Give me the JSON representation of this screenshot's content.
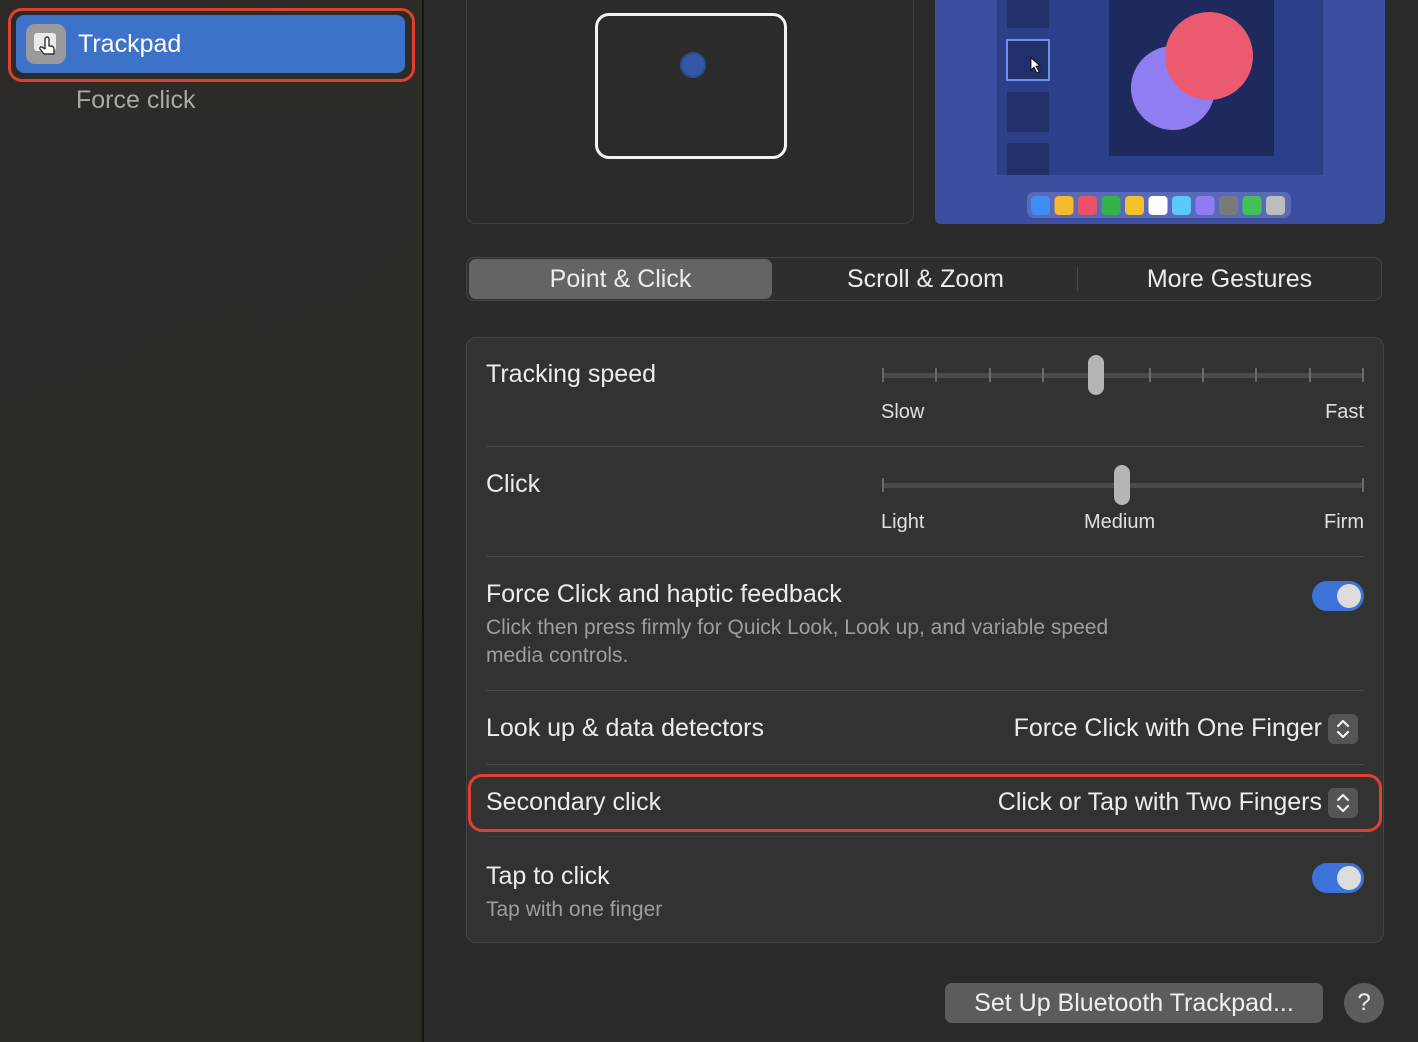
{
  "sidebar": {
    "selected_item": {
      "label": "Trackpad",
      "icon": "trackpad-hand-icon"
    },
    "sub_item": {
      "label": "Force click"
    }
  },
  "preview": {
    "trackpad_icon": "trackpad-outline-icon",
    "dock_colors": [
      "#3d8ef5",
      "#f5b92e",
      "#ea5367",
      "#36b24a",
      "#f3c12a",
      "#ffffff",
      "#5ac8fa",
      "#8e7cf0",
      "#7a7a7a",
      "#42c15a",
      "#bdbdbd"
    ]
  },
  "tabs": [
    {
      "label": "Point & Click",
      "active": true
    },
    {
      "label": "Scroll & Zoom",
      "active": false
    },
    {
      "label": "More Gestures",
      "active": false
    }
  ],
  "settings": {
    "tracking_speed": {
      "title": "Tracking speed",
      "min_label": "Slow",
      "max_label": "Fast",
      "ticks": 10,
      "value_index": 4
    },
    "click": {
      "title": "Click",
      "labels": [
        "Light",
        "Medium",
        "Firm"
      ],
      "value_index": 1
    },
    "force_click": {
      "title": "Force Click and haptic feedback",
      "description_line1": "Click then press firmly for Quick Look, Look up, and variable speed",
      "description_line2": "media controls.",
      "enabled": true
    },
    "look_up": {
      "title": "Look up & data detectors",
      "value": "Force Click with One Finger"
    },
    "secondary_click": {
      "title": "Secondary click",
      "value": "Click or Tap with Two Fingers"
    },
    "tap_to_click": {
      "title": "Tap to click",
      "description": "Tap with one finger",
      "enabled": true
    }
  },
  "footer": {
    "bluetooth_button": "Set Up Bluetooth Trackpad...",
    "help_button": "?"
  },
  "colors": {
    "accent": "#3d72c9",
    "highlight": "#e0402e",
    "toggle_on": "#3d72d8"
  }
}
